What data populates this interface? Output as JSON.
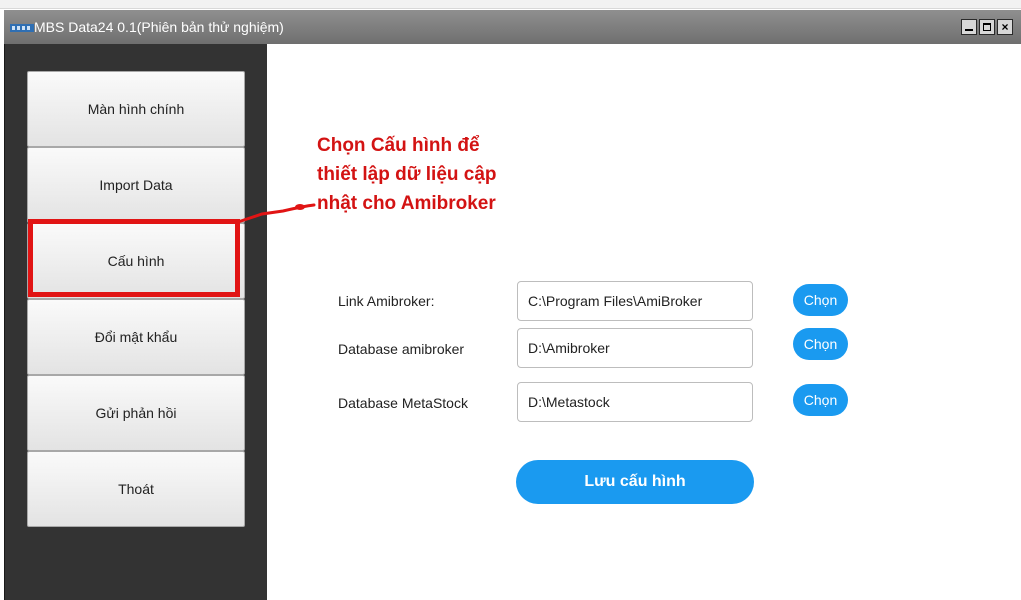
{
  "window": {
    "title": "MBS Data24 0.1(Phiên bản thử nghiệm)",
    "controls": {
      "minimize": "minimize",
      "maximize": "maximize",
      "close": "×"
    }
  },
  "sidebar": {
    "items": [
      {
        "label": "Màn hình chính"
      },
      {
        "label": "Import Data"
      },
      {
        "label": "Cấu hình",
        "highlighted": true
      },
      {
        "label": "Đổi mật khẩu"
      },
      {
        "label": "Gửi phản hồi"
      },
      {
        "label": "Thoát"
      }
    ]
  },
  "annotation": {
    "lines": [
      "Chọn Cấu hình để",
      "thiết lập dữ liệu cập",
      "nhật cho Amibroker"
    ],
    "color": "#d31313"
  },
  "form": {
    "fields": [
      {
        "label": "Link Amibroker:",
        "value": "C:\\Program Files\\AmiBroker",
        "button": "Chọn"
      },
      {
        "label": "Database amibroker",
        "value": "D:\\Amibroker",
        "button": "Chọn"
      },
      {
        "label": "Database MetaStock",
        "value": "D:\\Metastock",
        "button": "Chọn"
      }
    ],
    "save_label": "Lưu cấu hình"
  },
  "colors": {
    "accent": "#1a9af0",
    "sidebar_bg": "#333333",
    "highlight": "#e11414"
  }
}
